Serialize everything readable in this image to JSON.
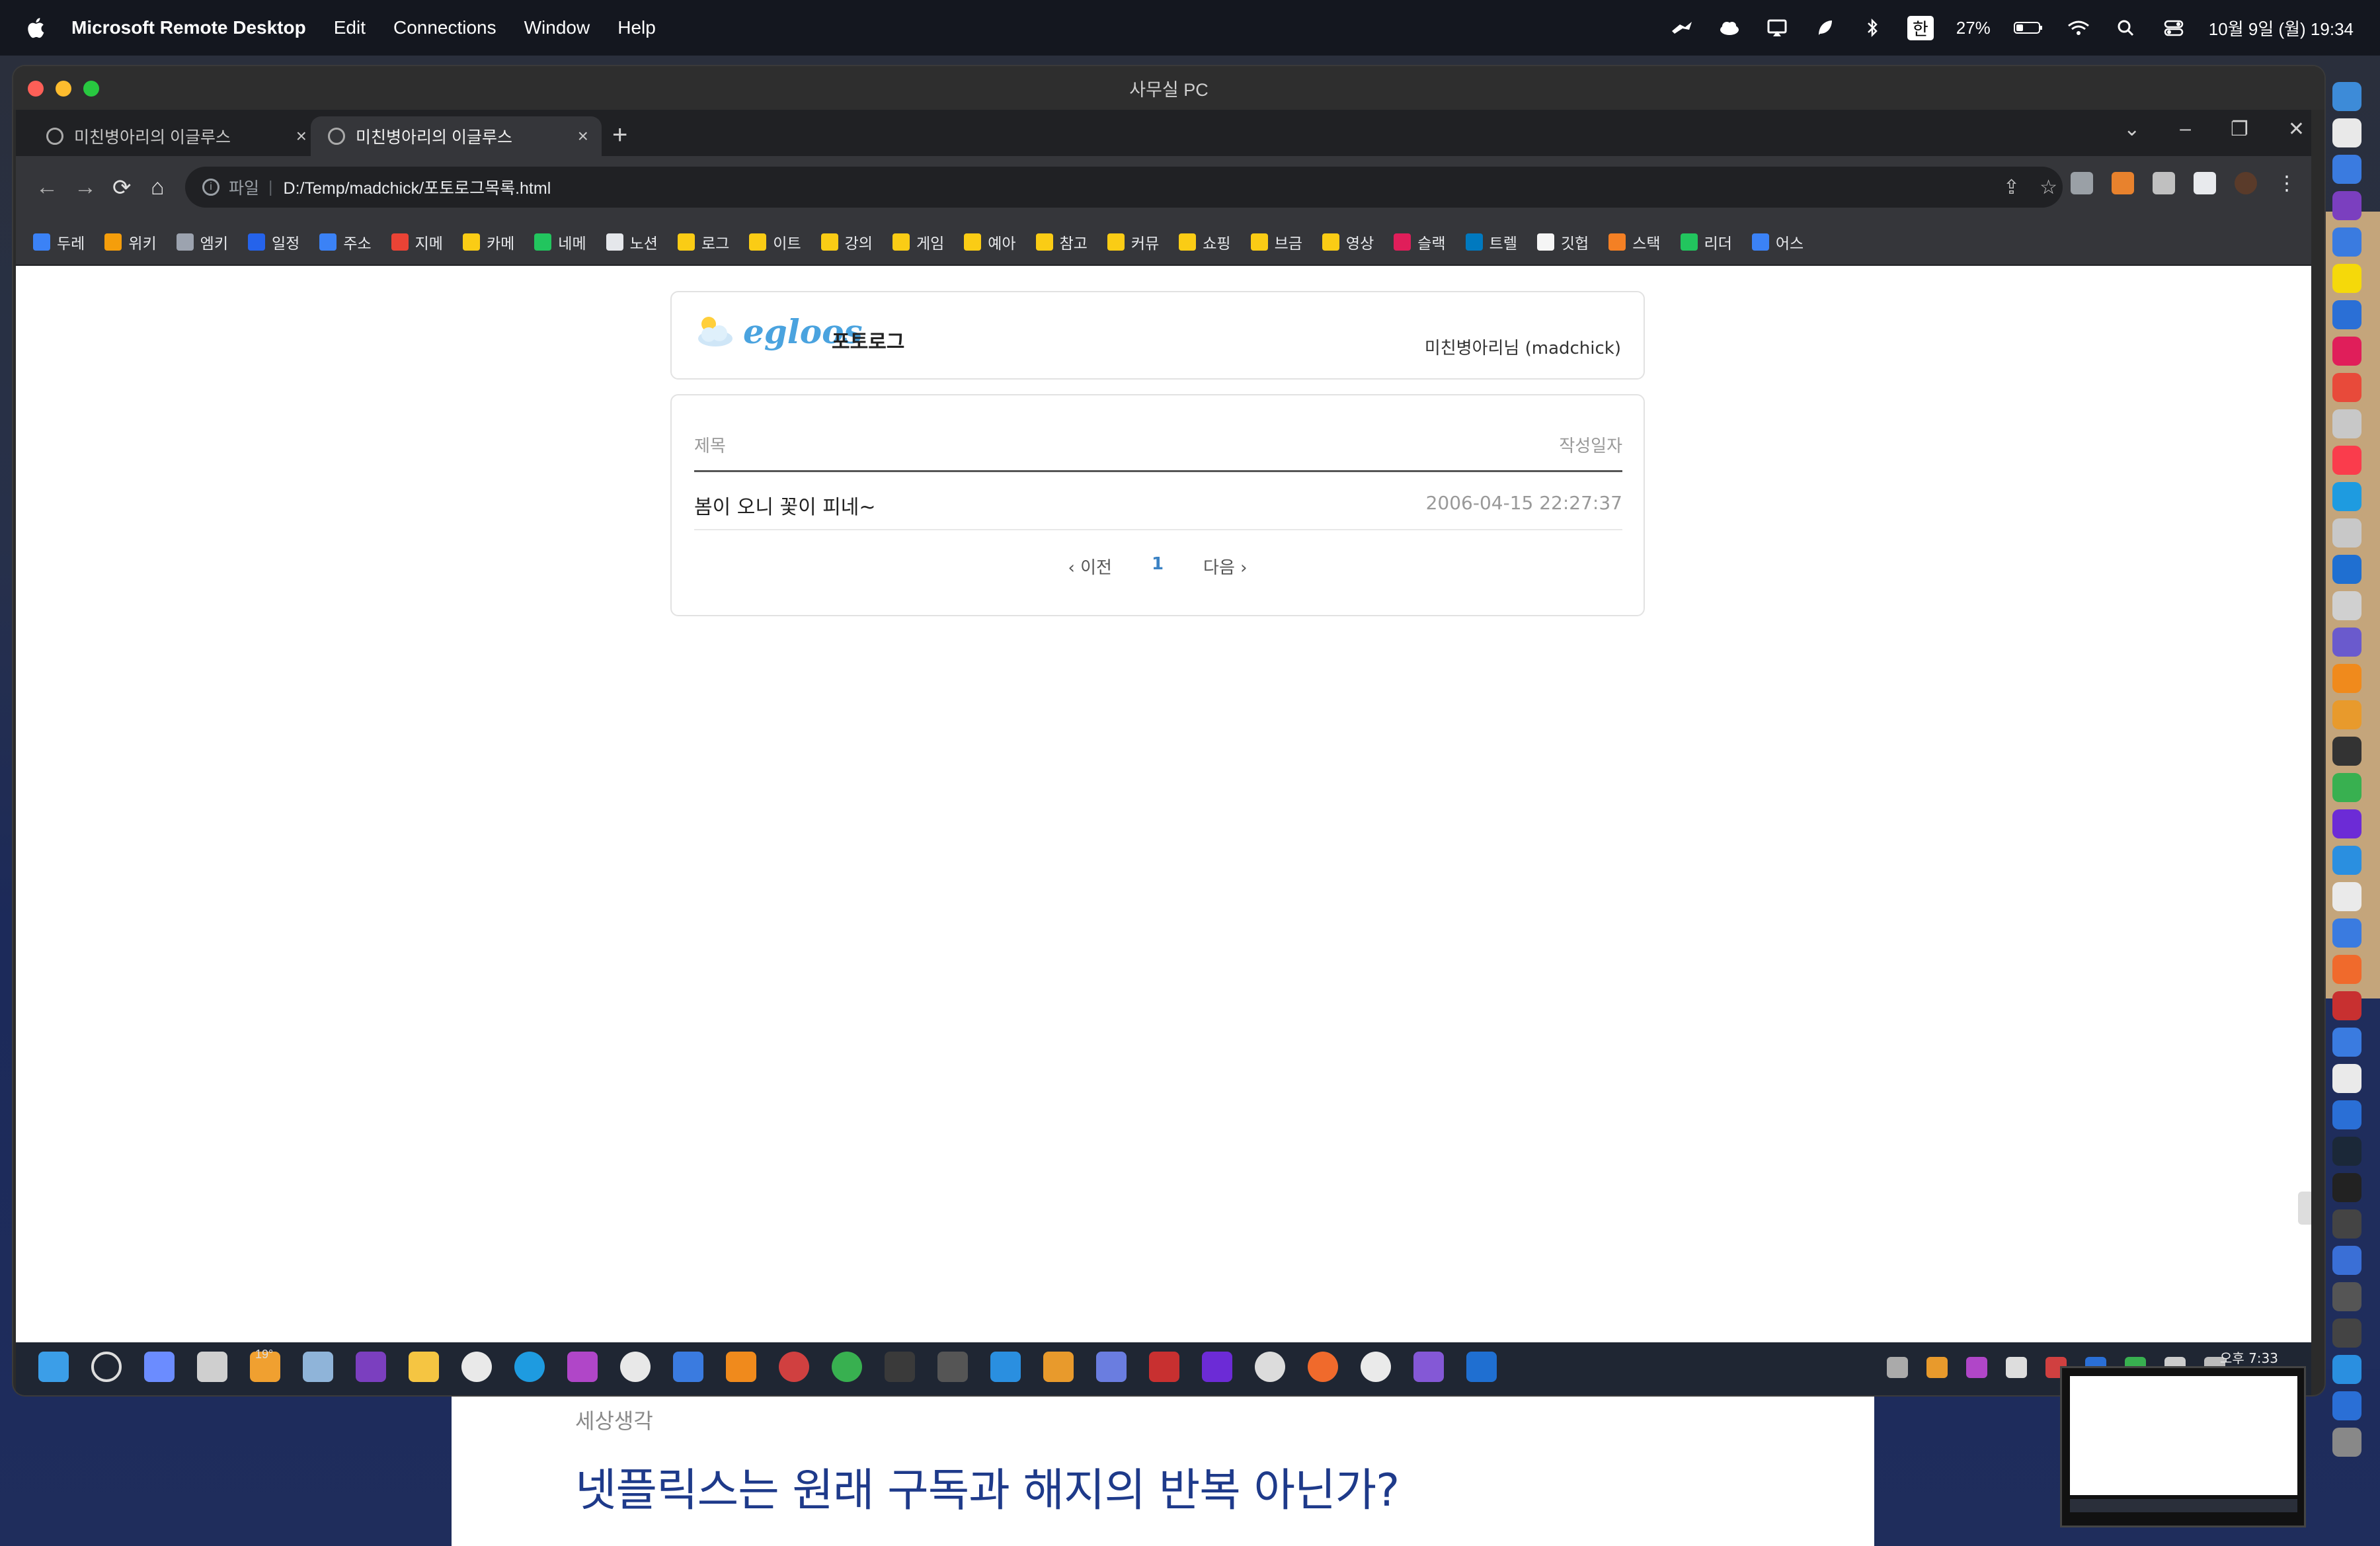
{
  "macos": {
    "app_name": "Microsoft Remote Desktop",
    "menus": [
      "Edit",
      "Connections",
      "Window",
      "Help"
    ],
    "ime_label": "한",
    "battery_percent": "27%",
    "datetime": "10월 9일 (월) 19:34"
  },
  "rd_window": {
    "title": "사무실 PC"
  },
  "chrome": {
    "tabs": [
      {
        "label": "미친병아리의 이글루스",
        "active": false
      },
      {
        "label": "미친병아리의 이글루스",
        "active": true
      }
    ],
    "address": {
      "scheme_label": "파일",
      "url": "D:/Temp/madchick/포토로그목록.html"
    },
    "bookmarks": [
      {
        "label": "두레",
        "color": "#3b82f6"
      },
      {
        "label": "위키",
        "color": "#f59e0b"
      },
      {
        "label": "엠키",
        "color": "#9ca3af"
      },
      {
        "label": "일정",
        "color": "#2563eb"
      },
      {
        "label": "주소",
        "color": "#3b82f6"
      },
      {
        "label": "지메",
        "color": "#ea4335"
      },
      {
        "label": "카메",
        "color": "#facc15"
      },
      {
        "label": "네메",
        "color": "#22c55e"
      },
      {
        "label": "노션",
        "color": "#e5e7eb"
      },
      {
        "label": "로그",
        "color": "#facc15"
      },
      {
        "label": "이트",
        "color": "#facc15"
      },
      {
        "label": "강의",
        "color": "#facc15"
      },
      {
        "label": "게임",
        "color": "#facc15"
      },
      {
        "label": "예아",
        "color": "#facc15"
      },
      {
        "label": "참고",
        "color": "#facc15"
      },
      {
        "label": "커뮤",
        "color": "#facc15"
      },
      {
        "label": "쇼핑",
        "color": "#facc15"
      },
      {
        "label": "브금",
        "color": "#facc15"
      },
      {
        "label": "영상",
        "color": "#facc15"
      },
      {
        "label": "슬랙",
        "color": "#e01e5a"
      },
      {
        "label": "트렐",
        "color": "#0079bf"
      },
      {
        "label": "깃헙",
        "color": "#f5f5f5"
      },
      {
        "label": "스택",
        "color": "#f48024"
      },
      {
        "label": "리더",
        "color": "#22c55e"
      },
      {
        "label": "어스",
        "color": "#3b82f6"
      }
    ]
  },
  "egloos": {
    "logo_text": "egloos",
    "section_title": "포토로그",
    "user": "미친병아리님 (madchick)",
    "columns": {
      "title": "제목",
      "date": "작성일자"
    },
    "rows": [
      {
        "title": "봄이 오니 꽃이 피네~",
        "date": "2006-04-15 22:27:37"
      }
    ],
    "pager": {
      "prev": "‹ 이전",
      "current": "1",
      "next": "다음 ›"
    }
  },
  "taskbar": {
    "weather": "19°",
    "clock": "오후 7:33"
  },
  "background_blog": {
    "category": "세상생각",
    "title": "넷플릭스는 원래 구독과 해지의 반복 아닌가?"
  }
}
